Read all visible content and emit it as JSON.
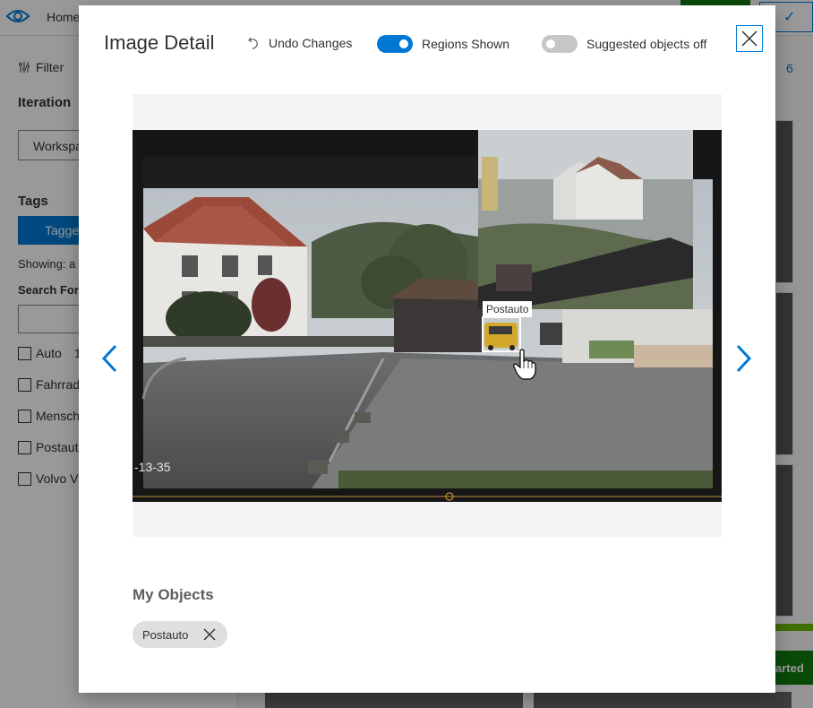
{
  "background": {
    "nav_home": "Home",
    "filter_label": "Filter",
    "iteration_label": "Iteration",
    "workspace_value": "Workspa",
    "tags_label": "Tags",
    "tagged_button": "Tagged",
    "showing_text": "Showing: a",
    "search_for_label": "Search For",
    "count_label": "6",
    "tag_list": [
      {
        "label": "Auto",
        "count": "1"
      },
      {
        "label": "Fahrrad",
        "count": ""
      },
      {
        "label": "Mensch",
        "count": ""
      },
      {
        "label": "Postauto",
        "count": ""
      },
      {
        "label": "Volvo V",
        "count": ""
      }
    ],
    "get_started_label": "arted"
  },
  "modal": {
    "title": "Image Detail",
    "undo_label": "Undo Changes",
    "regions_toggle": {
      "label": "Regions Shown",
      "state": "on"
    },
    "suggested_toggle": {
      "label": "Suggested objects off",
      "state": "off"
    },
    "timestamp_overlay": "-13-35",
    "region": {
      "tag": "Postauto"
    },
    "my_objects_heading": "My Objects",
    "objects": [
      {
        "label": "Postauto"
      }
    ]
  },
  "colors": {
    "accent": "#0078d4",
    "success": "#107c10",
    "chip_bg": "#e1dfdd"
  },
  "icons": {
    "eye": "eye-icon",
    "filter": "filter-icon",
    "undo": "undo-icon",
    "close": "close-icon",
    "prev": "chevron-left-icon",
    "next": "chevron-right-icon",
    "remove_tag": "remove-tag-icon",
    "cursor": "hand-cursor-icon"
  }
}
